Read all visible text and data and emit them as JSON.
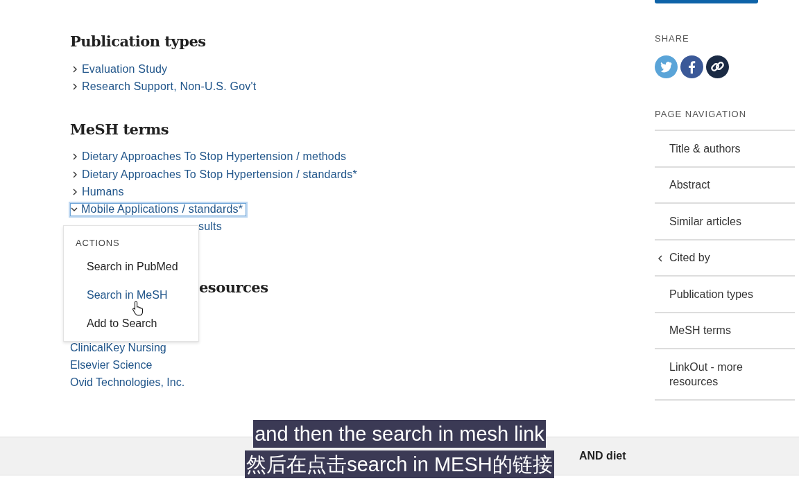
{
  "publication_types": {
    "heading": "Publication types",
    "items": [
      {
        "label": "Evaluation Study",
        "expanded": false
      },
      {
        "label": "Research Support, Non-U.S. Gov't",
        "expanded": false
      }
    ]
  },
  "mesh_terms": {
    "heading": "MeSH terms",
    "items": [
      {
        "label": "Dietary Approaches To Stop Hypertension / methods",
        "expanded": false
      },
      {
        "label": "Dietary Approaches To Stop Hypertension / standards*",
        "expanded": false
      },
      {
        "label": "Humans",
        "expanded": false
      },
      {
        "label": "Mobile Applications / standards*",
        "expanded": true
      },
      {
        "label": "sults",
        "kind": "fragment"
      }
    ]
  },
  "linkout": {
    "heading": "esources",
    "items": [
      "ClinicalKey Nursing",
      "Elsevier Science",
      "Ovid Technologies, Inc."
    ]
  },
  "actions_menu": {
    "title": "ACTIONS",
    "items": [
      {
        "label": "Search in PubMed",
        "hovered": false
      },
      {
        "label": "Search in MeSH",
        "hovered": true
      },
      {
        "label": "Add to Search",
        "hovered": false
      }
    ]
  },
  "share": {
    "title": "SHARE"
  },
  "page_navigation": {
    "title": "PAGE NAVIGATION",
    "items": [
      {
        "label": "Title & authors",
        "current": false
      },
      {
        "label": "Abstract",
        "current": false
      },
      {
        "label": "Similar articles",
        "current": false
      },
      {
        "label": "Cited by",
        "current": true
      },
      {
        "label": "Publication types",
        "current": false
      },
      {
        "label": "MeSH terms",
        "current": false
      },
      {
        "label": "LinkOut - more resources",
        "current": false
      }
    ]
  },
  "bottom_bar": {
    "text": "AND diet"
  },
  "subtitles": [
    "and then the search in mesh link",
    "然后在点击search in MESH的链接"
  ]
}
